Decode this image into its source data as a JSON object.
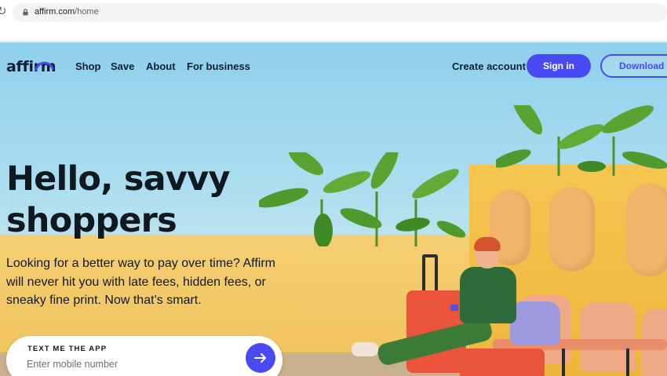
{
  "browser": {
    "url_domain": "affirm.com",
    "url_path": "/home"
  },
  "nav": {
    "logo": "affirm",
    "links": [
      "Shop",
      "Save",
      "About",
      "For business"
    ],
    "create_account": "Create account",
    "sign_in": "Sign in",
    "download": "Download app"
  },
  "hero": {
    "headline_line1": "Hello, savvy",
    "headline_line2": "shoppers",
    "subcopy_line1": "Looking for a better way to pay over time? Affirm",
    "subcopy_line2": "will never hit you with late fees, hidden fees, or",
    "subcopy_line3": "sneaky fine print. Now that’s smart."
  },
  "text_app_form": {
    "label": "TEXT ME THE APP",
    "placeholder": "Enter mobile number",
    "value": ""
  },
  "colors": {
    "brand": "#4a4af4",
    "text": "#101820",
    "sky": "#8fd0ec",
    "wall": "#f5cf73"
  },
  "icons": {
    "reload": "reload-icon",
    "lock": "lock-icon",
    "logo_arc": "affirm-arc-icon",
    "submit": "arrow-right-icon"
  }
}
